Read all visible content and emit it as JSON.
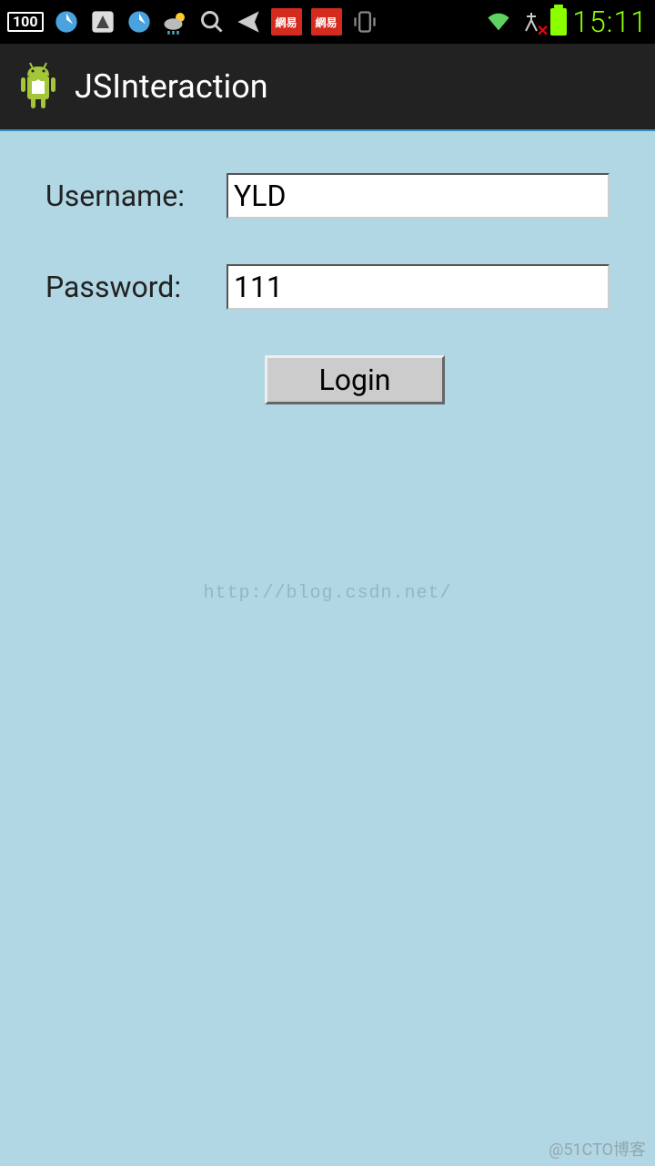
{
  "statusbar": {
    "battery_percent": "100",
    "netease_label": "網易",
    "clock": "15:11"
  },
  "appbar": {
    "title": "JSInteraction"
  },
  "form": {
    "username_label": "Username:",
    "username_value": "YLD",
    "password_label": "Password:",
    "password_value": "111",
    "login_button": "Login"
  },
  "watermark": {
    "center": "http://blog.csdn.net/",
    "corner": "@51CTO博客"
  }
}
